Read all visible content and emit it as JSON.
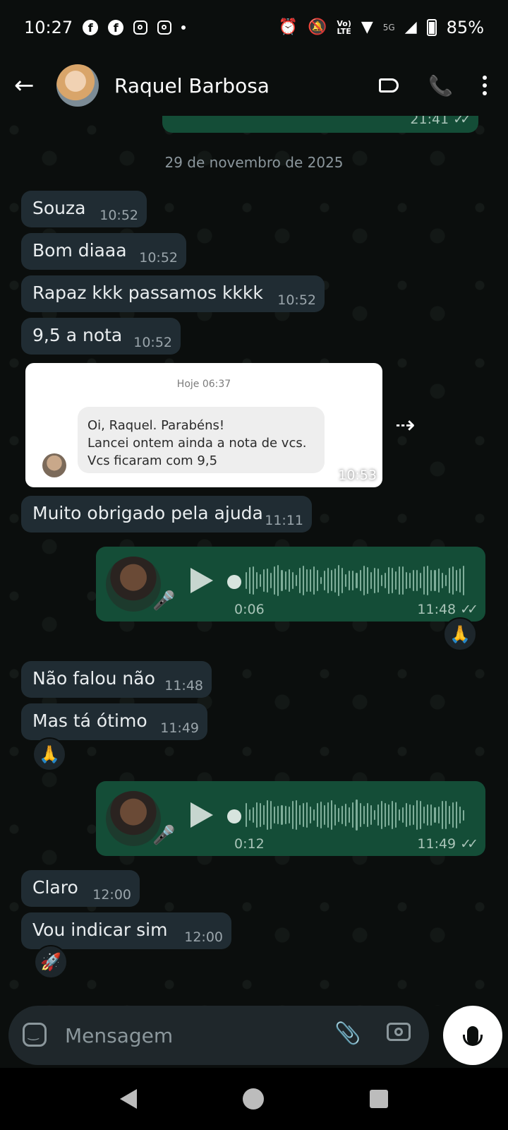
{
  "status": {
    "time": "10:27",
    "battery": "85%",
    "battery_level": 0.85,
    "network": "5G",
    "lte_line1": "Vo)",
    "lte_line2": "LTE"
  },
  "header": {
    "contact_name": "Raquel Barbosa"
  },
  "chat": {
    "top_out_time": "21:41",
    "date_chip": "29 de novembro de 2025",
    "messages": [
      {
        "text": "Souza",
        "time": "10:52"
      },
      {
        "text": "Bom diaaa",
        "time": "10:52"
      },
      {
        "text": "Rapaz kkk passamos kkkk",
        "time": "10:52"
      },
      {
        "text": "9,5 a nota",
        "time": "10:52"
      },
      {
        "text": "Muito obrigado pela ajuda",
        "time": "11:11"
      },
      {
        "text": "Não falou não",
        "time": "11:48"
      },
      {
        "text": "Mas tá ótimo",
        "time": "11:49"
      },
      {
        "text": "Claro",
        "time": "12:00"
      },
      {
        "text": "Vou indicar sim",
        "time": "12:00"
      }
    ],
    "image_message": {
      "date": "Hoje 06:37",
      "lines": [
        "Oi, Raquel. Parabéns!",
        "Lancei ontem ainda a nota de vcs.",
        "Vcs ficaram com 9,5"
      ],
      "time": "10:53"
    },
    "audio": [
      {
        "duration": "0:06",
        "time": "11:48"
      },
      {
        "duration": "0:12",
        "time": "11:49"
      }
    ],
    "reactions": [
      "🙏",
      "🙏",
      "🚀"
    ]
  },
  "composer": {
    "placeholder": "Mensagem"
  }
}
